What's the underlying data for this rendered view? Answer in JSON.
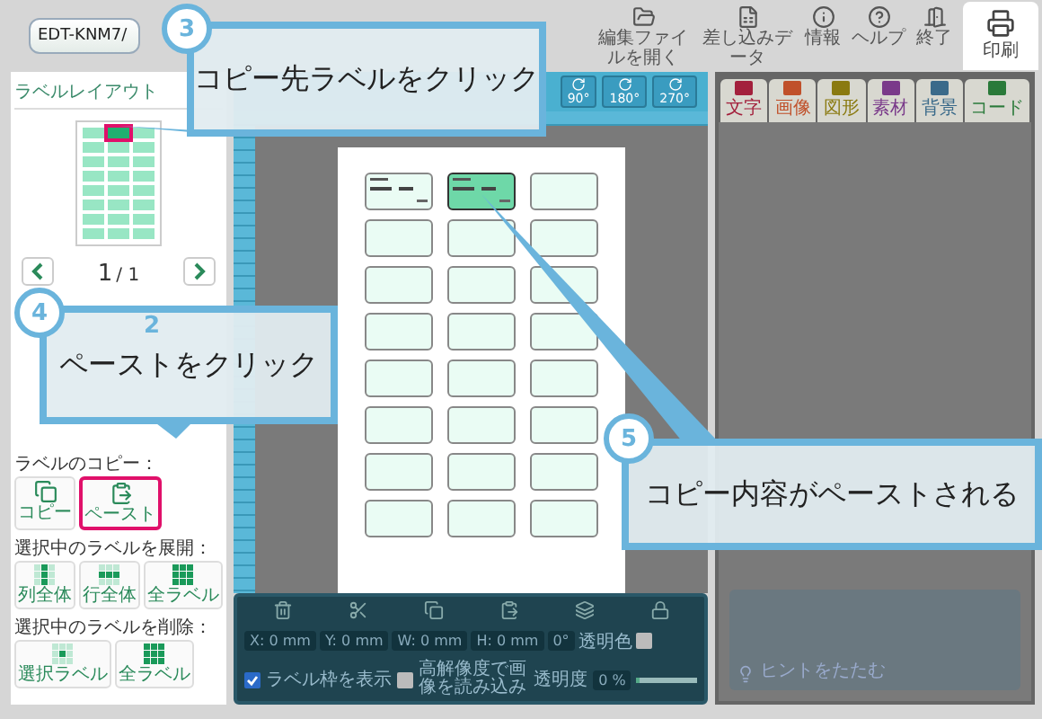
{
  "file_field": {
    "value": "EDT-KNM7/"
  },
  "toolbar": [
    {
      "label": "編集ファイルを開く"
    },
    {
      "label": "差し込みデータ"
    },
    {
      "label": "情報"
    },
    {
      "label": "ヘルプ"
    },
    {
      "label": "終了"
    }
  ],
  "print_button": {
    "label": "印刷"
  },
  "layout_panel": {
    "title": "ラベルレイアウト"
  },
  "pager": {
    "current": "1",
    "separator": "/",
    "total": "1"
  },
  "copy_section": {
    "title": "ラベルのコピー：",
    "buttons": [
      {
        "label": "コピー",
        "kind": "copy",
        "highlighted": false
      },
      {
        "label": "ペースト",
        "kind": "paste",
        "highlighted": true
      }
    ]
  },
  "expand_section": {
    "title": "選択中のラベルを展開：",
    "buttons": [
      {
        "label": "列全体",
        "kind": "column"
      },
      {
        "label": "行全体",
        "kind": "row"
      },
      {
        "label": "全ラベル",
        "kind": "all"
      }
    ]
  },
  "delete_section": {
    "title": "選択中のラベルを削除：",
    "buttons": [
      {
        "label": "選択ラベル",
        "kind": "single"
      },
      {
        "label": "全ラベル",
        "kind": "all"
      }
    ]
  },
  "rotate_buttons": [
    {
      "label": "90°"
    },
    {
      "label": "180°"
    },
    {
      "label": "270°"
    }
  ],
  "panel_tabs": [
    {
      "label": "文字",
      "color": "#a3203c"
    },
    {
      "label": "画像",
      "color": "#c0502a"
    },
    {
      "label": "図形",
      "color": "#8a7a10"
    },
    {
      "label": "素材",
      "color": "#7a3a8a"
    },
    {
      "label": "背景",
      "color": "#3a6a8a"
    },
    {
      "label": "コード",
      "color": "#2a7a3a"
    }
  ],
  "sheet": {
    "labels": [
      {
        "filled": true,
        "selected": false
      },
      {
        "filled": true,
        "selected": true
      },
      {
        "filled": false,
        "selected": false
      },
      {
        "filled": false,
        "selected": false
      },
      {
        "filled": false,
        "selected": false
      },
      {
        "filled": false,
        "selected": false
      },
      {
        "filled": false,
        "selected": false
      },
      {
        "filled": false,
        "selected": false
      },
      {
        "filled": false,
        "selected": false
      },
      {
        "filled": false,
        "selected": false
      },
      {
        "filled": false,
        "selected": false
      },
      {
        "filled": false,
        "selected": false
      },
      {
        "filled": false,
        "selected": false
      },
      {
        "filled": false,
        "selected": false
      },
      {
        "filled": false,
        "selected": false
      },
      {
        "filled": false,
        "selected": false
      },
      {
        "filled": false,
        "selected": false
      },
      {
        "filled": false,
        "selected": false
      },
      {
        "filled": false,
        "selected": false
      },
      {
        "filled": false,
        "selected": false
      },
      {
        "filled": false,
        "selected": false
      },
      {
        "filled": false,
        "selected": false
      },
      {
        "filled": false,
        "selected": false
      },
      {
        "filled": false,
        "selected": false
      }
    ]
  },
  "bottom_panel": {
    "fields": [
      {
        "label": "X:",
        "value": "0",
        "unit": "mm"
      },
      {
        "label": "Y:",
        "value": "0",
        "unit": "mm"
      },
      {
        "label": "W:",
        "value": "0",
        "unit": "mm"
      },
      {
        "label": "H:",
        "value": "0",
        "unit": "mm"
      }
    ],
    "angle": "0°",
    "transparent_color": {
      "label": "透明色",
      "checked": false
    },
    "show_frame": {
      "label": "ラベル枠を表示",
      "checked": true
    },
    "hi_res": {
      "label": "高解像度で画像を読み込み",
      "checked": false
    },
    "opacity": {
      "label": "透明度",
      "value": "0 %",
      "level": 0.05
    }
  },
  "hint": {
    "label": "ヒントをたたむ"
  },
  "callouts": [
    {
      "number": "3",
      "text": "コピー先ラベルをクリック"
    },
    {
      "number": "4",
      "note": "2",
      "text": "ペーストをクリック"
    },
    {
      "number": "5",
      "text": "コピー内容がペーストされる"
    }
  ]
}
